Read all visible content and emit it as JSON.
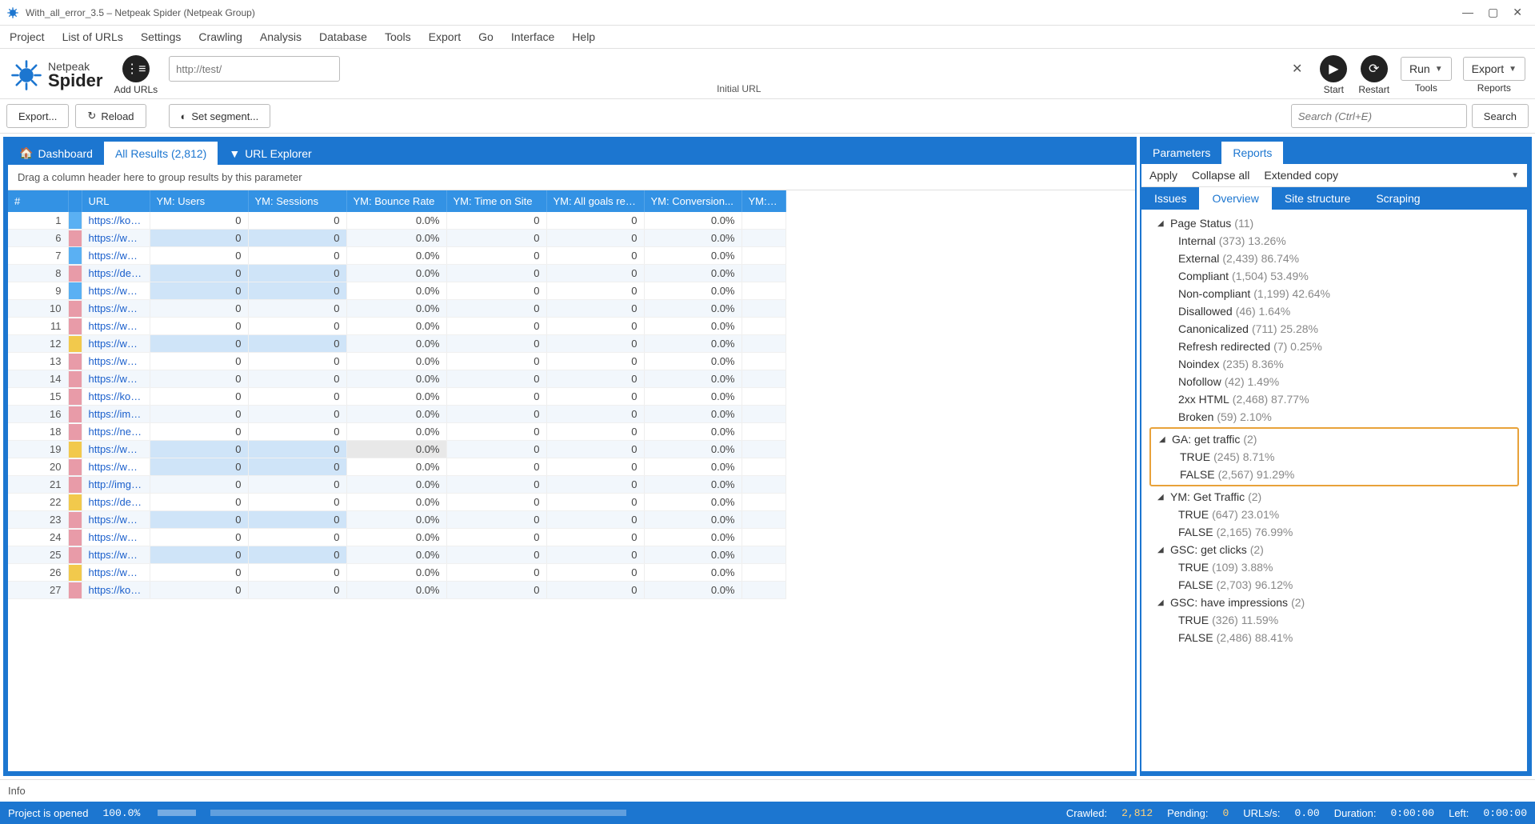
{
  "window": {
    "title": "With_all_error_3.5 – Netpeak Spider (Netpeak Group)",
    "min": "—",
    "max": "▢",
    "close": "✕"
  },
  "menu": [
    "Project",
    "List of URLs",
    "Settings",
    "Crawling",
    "Analysis",
    "Database",
    "Tools",
    "Export",
    "Go",
    "Interface",
    "Help"
  ],
  "logo": {
    "l1": "Netpeak",
    "l2": "Spider"
  },
  "toolbar": {
    "add_urls": "Add URLs",
    "url_placeholder": "http://test/",
    "initial_url": "Initial URL",
    "start": "Start",
    "restart": "Restart",
    "run": "Run",
    "tools_sub": "Tools",
    "export": "Export",
    "reports_sub": "Reports"
  },
  "subtoolbar": {
    "export": "Export...",
    "reload": "Reload",
    "set_segment": "Set segment...",
    "search_ph": "Search (Ctrl+E)",
    "search_btn": "Search"
  },
  "left_tabs": {
    "dashboard": "Dashboard",
    "all_results": "All Results (2,812)",
    "url_explorer": "URL Explorer"
  },
  "group_hint": "Drag a column header here to group results by this parameter",
  "columns": [
    "#",
    "URL",
    "YM: Users",
    "YM: Sessions",
    "YM: Bounce Rate",
    "YM: Time on Site",
    "YM: All goals rea...",
    "YM: Conversion...",
    "YM: Nur"
  ],
  "rows": [
    {
      "n": 1,
      "url": "https://korr...",
      "mk": "",
      "u": 0,
      "s": 0,
      "b": "0.0%",
      "t": 0,
      "g": 0,
      "c": "0.0%",
      "alt": false,
      "hl": false
    },
    {
      "n": 6,
      "url": "https://www....",
      "mk": "pink",
      "u": 0,
      "s": 0,
      "b": "0.0%",
      "t": 0,
      "g": 0,
      "c": "0.0%",
      "alt": true,
      "hl": true
    },
    {
      "n": 7,
      "url": "https://www....",
      "mk": "",
      "u": 0,
      "s": 0,
      "b": "0.0%",
      "t": 0,
      "g": 0,
      "c": "0.0%",
      "alt": false,
      "hl": false
    },
    {
      "n": 8,
      "url": "https://deve...",
      "mk": "pink",
      "u": 0,
      "s": 0,
      "b": "0.0%",
      "t": 0,
      "g": 0,
      "c": "0.0%",
      "alt": true,
      "hl": true
    },
    {
      "n": 9,
      "url": "https://www....",
      "mk": "",
      "u": 0,
      "s": 0,
      "b": "0.0%",
      "t": 0,
      "g": 0,
      "c": "0.0%",
      "alt": false,
      "hl": true
    },
    {
      "n": 10,
      "url": "https://www....",
      "mk": "pink",
      "u": 0,
      "s": 0,
      "b": "0.0%",
      "t": 0,
      "g": 0,
      "c": "0.0%",
      "alt": true,
      "hl": false
    },
    {
      "n": 11,
      "url": "https://www....",
      "mk": "pink",
      "u": 0,
      "s": 0,
      "b": "0.0%",
      "t": 0,
      "g": 0,
      "c": "0.0%",
      "alt": false,
      "hl": false
    },
    {
      "n": 12,
      "url": "https://www....",
      "mk": "yellow",
      "u": 0,
      "s": 0,
      "b": "0.0%",
      "t": 0,
      "g": 0,
      "c": "0.0%",
      "alt": true,
      "hl": true
    },
    {
      "n": 13,
      "url": "https://www....",
      "mk": "pink",
      "u": 0,
      "s": 0,
      "b": "0.0%",
      "t": 0,
      "g": 0,
      "c": "0.0%",
      "alt": false,
      "hl": false
    },
    {
      "n": 14,
      "url": "https://www....",
      "mk": "pink",
      "u": 0,
      "s": 0,
      "b": "0.0%",
      "t": 0,
      "g": 0,
      "c": "0.0%",
      "alt": true,
      "hl": false
    },
    {
      "n": 15,
      "url": "https://kor.il...",
      "mk": "pink",
      "u": 0,
      "s": 0,
      "b": "0.0%",
      "t": 0,
      "g": 0,
      "c": "0.0%",
      "alt": false,
      "hl": false
    },
    {
      "n": 16,
      "url": "https://imag...",
      "mk": "pink",
      "u": 0,
      "s": 0,
      "b": "0.0%",
      "t": 0,
      "g": 0,
      "c": "0.0%",
      "alt": true,
      "hl": false
    },
    {
      "n": 18,
      "url": "https://netp...",
      "mk": "pink",
      "u": 0,
      "s": 0,
      "b": "0.0%",
      "t": 0,
      "g": 0,
      "c": "0.0%",
      "alt": false,
      "hl": false
    },
    {
      "n": 19,
      "url": "https://www....",
      "mk": "yellow",
      "u": 0,
      "s": 0,
      "b": "0.0%",
      "t": 0,
      "g": 0,
      "c": "0.0%",
      "alt": true,
      "hl": true,
      "sel": true
    },
    {
      "n": 20,
      "url": "https://www....",
      "mk": "pink",
      "u": 0,
      "s": 0,
      "b": "0.0%",
      "t": 0,
      "g": 0,
      "c": "0.0%",
      "alt": false,
      "hl": true
    },
    {
      "n": 21,
      "url": "http://img.y...",
      "mk": "pink",
      "u": 0,
      "s": 0,
      "b": "0.0%",
      "t": 0,
      "g": 0,
      "c": "0.0%",
      "alt": true,
      "hl": false
    },
    {
      "n": 22,
      "url": "https://deve...",
      "mk": "yellow",
      "u": 0,
      "s": 0,
      "b": "0.0%",
      "t": 0,
      "g": 0,
      "c": "0.0%",
      "alt": false,
      "hl": false
    },
    {
      "n": 23,
      "url": "https://www....",
      "mk": "pink",
      "u": 0,
      "s": 0,
      "b": "0.0%",
      "t": 0,
      "g": 0,
      "c": "0.0%",
      "alt": true,
      "hl": true
    },
    {
      "n": 24,
      "url": "https://www....",
      "mk": "pink",
      "u": 0,
      "s": 0,
      "b": "0.0%",
      "t": 0,
      "g": 0,
      "c": "0.0%",
      "alt": false,
      "hl": false
    },
    {
      "n": 25,
      "url": "https://www....",
      "mk": "pink",
      "u": 0,
      "s": 0,
      "b": "0.0%",
      "t": 0,
      "g": 0,
      "c": "0.0%",
      "alt": true,
      "hl": true
    },
    {
      "n": 26,
      "url": "https://www....",
      "mk": "yellow",
      "u": 0,
      "s": 0,
      "b": "0.0%",
      "t": 0,
      "g": 0,
      "c": "0.0%",
      "alt": false,
      "hl": false
    },
    {
      "n": 27,
      "url": "https://korr...",
      "mk": "pink",
      "u": 0,
      "s": 0,
      "b": "0.0%",
      "t": 0,
      "g": 0,
      "c": "0.0%",
      "alt": true,
      "hl": false
    }
  ],
  "right_tabs": {
    "parameters": "Parameters",
    "reports": "Reports"
  },
  "right_actions": {
    "apply": "Apply",
    "collapse": "Collapse all",
    "extended": "Extended copy"
  },
  "right_sub_tabs": {
    "issues": "Issues",
    "overview": "Overview",
    "site_structure": "Site structure",
    "scraping": "Scraping"
  },
  "tree": [
    {
      "lvl": 1,
      "caret": true,
      "label": "Page Status",
      "meta": "(11)"
    },
    {
      "lvl": 2,
      "label": "Internal",
      "meta": "(373) 13.26%"
    },
    {
      "lvl": 2,
      "label": "External",
      "meta": "(2,439) 86.74%"
    },
    {
      "lvl": 2,
      "label": "Compliant",
      "meta": "(1,504) 53.49%"
    },
    {
      "lvl": 2,
      "label": "Non-compliant",
      "meta": "(1,199) 42.64%"
    },
    {
      "lvl": 2,
      "label": "Disallowed",
      "meta": "(46) 1.64%"
    },
    {
      "lvl": 2,
      "label": "Canonicalized",
      "meta": "(711) 25.28%"
    },
    {
      "lvl": 2,
      "label": "Refresh redirected",
      "meta": "(7) 0.25%"
    },
    {
      "lvl": 2,
      "label": "Noindex",
      "meta": "(235) 8.36%"
    },
    {
      "lvl": 2,
      "label": "Nofollow",
      "meta": "(42) 1.49%"
    },
    {
      "lvl": 2,
      "label": "2xx HTML",
      "meta": "(2,468) 87.77%"
    },
    {
      "lvl": 2,
      "label": "Broken",
      "meta": "(59) 2.10%"
    },
    {
      "lvl": 1,
      "caret": true,
      "label": "GA: get traffic",
      "meta": "(2)",
      "hl": "start"
    },
    {
      "lvl": 2,
      "label": "TRUE",
      "meta": "(245) 8.71%",
      "hl": "mid"
    },
    {
      "lvl": 2,
      "label": "FALSE",
      "meta": "(2,567) 91.29%",
      "hl": "end"
    },
    {
      "lvl": 1,
      "caret": true,
      "label": "YM: Get Traffic",
      "meta": "(2)"
    },
    {
      "lvl": 2,
      "label": "TRUE",
      "meta": "(647) 23.01%"
    },
    {
      "lvl": 2,
      "label": "FALSE",
      "meta": "(2,165) 76.99%"
    },
    {
      "lvl": 1,
      "caret": true,
      "label": "GSC: get clicks",
      "meta": "(2)"
    },
    {
      "lvl": 2,
      "label": "TRUE",
      "meta": "(109) 3.88%"
    },
    {
      "lvl": 2,
      "label": "FALSE",
      "meta": "(2,703) 96.12%"
    },
    {
      "lvl": 1,
      "caret": true,
      "label": "GSC: have impressions",
      "meta": "(2)"
    },
    {
      "lvl": 2,
      "label": "TRUE",
      "meta": "(326) 11.59%"
    },
    {
      "lvl": 2,
      "label": "FALSE",
      "meta": "(2,486) 88.41%"
    }
  ],
  "info": "Info",
  "status": {
    "project": "Project is opened",
    "pct": "100.0%",
    "crawled_l": "Crawled:",
    "crawled_v": "2,812",
    "pending_l": "Pending:",
    "pending_v": "0",
    "urls_l": "URLs/s:",
    "urls_v": "0.00",
    "duration_l": "Duration:",
    "duration_v": "0:00:00",
    "left_l": "Left:",
    "left_v": "0:00:00"
  }
}
